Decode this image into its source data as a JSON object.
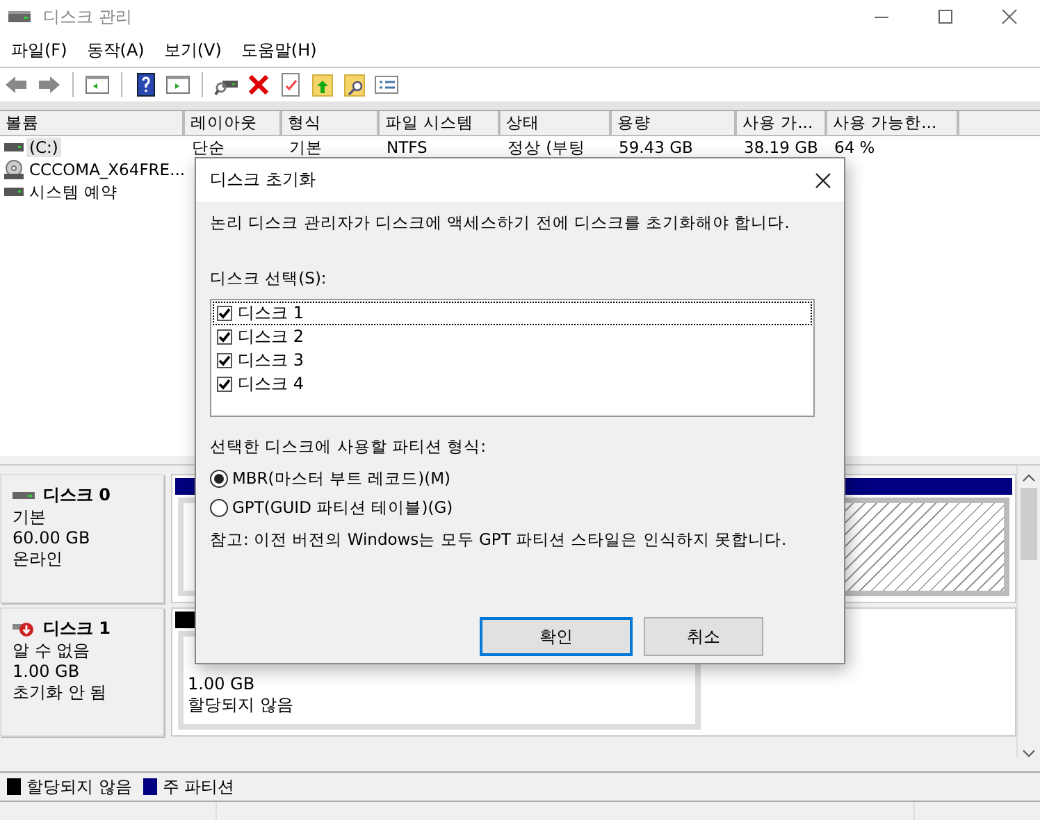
{
  "window": {
    "title": "디스크 관리"
  },
  "menu": [
    "파일(F)",
    "동작(A)",
    "보기(V)",
    "도움말(H)"
  ],
  "volume_table": {
    "columns": [
      "볼륨",
      "레이아웃",
      "형식",
      "파일 시스템",
      "상태",
      "용량",
      "사용 가...",
      "사용 가능한..."
    ],
    "rows": [
      {
        "kind": "drive",
        "selected": true,
        "volume": "(C:)",
        "layout": "단순",
        "type": "기본",
        "file_system": "NTFS",
        "status": "정상 (부팅",
        "capacity": "59.43 GB",
        "free": "38.19 GB",
        "free_pct": "64 %"
      },
      {
        "kind": "cdrom",
        "selected": false,
        "volume": "CCCOMA_X64FRE..."
      },
      {
        "kind": "drive",
        "selected": false,
        "volume": "시스템 예약"
      }
    ]
  },
  "disks": [
    {
      "name": "디스크 0",
      "warning": false,
      "lines": [
        "기본",
        "60.00 GB",
        "온라인"
      ],
      "partitions": [
        {
          "kind": "primary",
          "selected": false
        },
        {
          "kind": "primary",
          "selected": true
        }
      ]
    },
    {
      "name": "디스크 1",
      "warning": true,
      "lines": [
        "알 수 없음",
        "1.00 GB",
        "초기화 안 됨"
      ],
      "partitions": [
        {
          "kind": "unallocated",
          "selected": false,
          "lines": [
            "1.00 GB",
            "할당되지 않음"
          ]
        }
      ]
    }
  ],
  "legend": [
    {
      "label": "할당되지 않음",
      "color": "#000000"
    },
    {
      "label": "주 파티션",
      "color": "#000080"
    }
  ],
  "dialog": {
    "title": "디스크 초기화",
    "message": "논리 디스크 관리자가 디스크에 액세스하기 전에 디스크를 초기화해야 합니다.",
    "disk_list_label": "디스크 선택(S):",
    "disks": [
      {
        "label": "디스크 1",
        "checked": true,
        "selected": true
      },
      {
        "label": "디스크 2",
        "checked": true,
        "selected": false
      },
      {
        "label": "디스크 3",
        "checked": true,
        "selected": false
      },
      {
        "label": "디스크 4",
        "checked": true,
        "selected": false
      }
    ],
    "partition_style_label": "선택한 디스크에 사용할 파티션 형식:",
    "options": [
      {
        "label": "MBR(마스터 부트 레코드)(M)",
        "selected": true
      },
      {
        "label": "GPT(GUID 파티션 테이블)(G)",
        "selected": false
      }
    ],
    "note": "참고: 이전 버전의 Windows는 모두 GPT 파티션 스타일은 인식하지 못합니다.",
    "buttons": [
      {
        "label": "확인",
        "default": true
      },
      {
        "label": "취소",
        "default": false
      }
    ]
  }
}
